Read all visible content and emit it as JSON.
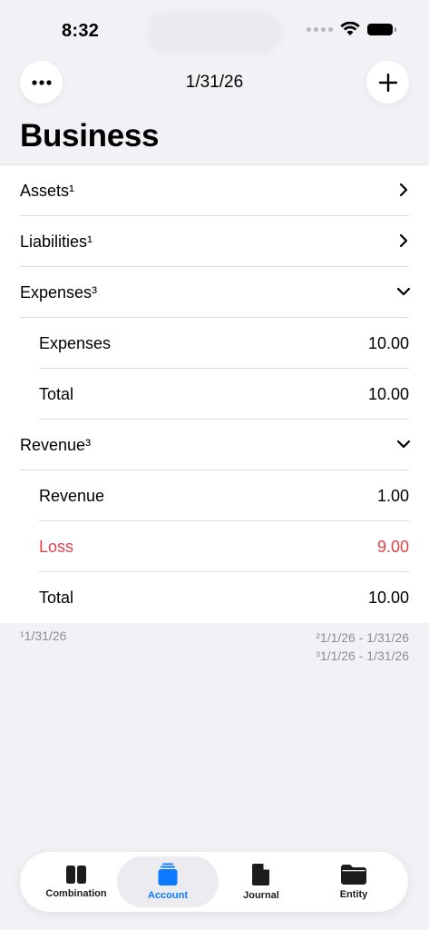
{
  "status_bar": {
    "time": "8:32"
  },
  "nav": {
    "date": "1/31/26",
    "more_icon": "ellipsis-icon",
    "add_icon": "plus-icon"
  },
  "title": "Business",
  "rows": [
    {
      "label": "Assets¹",
      "value": "",
      "indicator": "chevron-right"
    },
    {
      "label": "Liabilities¹",
      "value": "",
      "indicator": "chevron-right"
    },
    {
      "label": "Expenses³",
      "value": "",
      "indicator": "chevron-down"
    },
    {
      "label": "Expenses",
      "value": "10.00"
    },
    {
      "label": "Total",
      "value": "10.00"
    },
    {
      "label": "Revenue³",
      "value": "",
      "indicator": "chevron-down"
    },
    {
      "label": "Revenue",
      "value": "1.00"
    },
    {
      "label": "Loss",
      "value": "9.00"
    },
    {
      "label": "Total",
      "value": "10.00"
    }
  ],
  "footnotes": {
    "left": "¹1/31/26",
    "right_1": "²1/1/26 - 1/31/26",
    "right_2": "³1/1/26 - 1/31/26"
  },
  "tabs": [
    {
      "label": "Combination",
      "icon": "split-panel-icon"
    },
    {
      "label": "Account",
      "icon": "stack-icon"
    },
    {
      "label": "Journal",
      "icon": "document-icon"
    },
    {
      "label": "Entity",
      "icon": "folder-icon"
    }
  ],
  "colors": {
    "accent": "#0a7aff",
    "loss": "#e0424a",
    "background": "#f2f1f6"
  }
}
